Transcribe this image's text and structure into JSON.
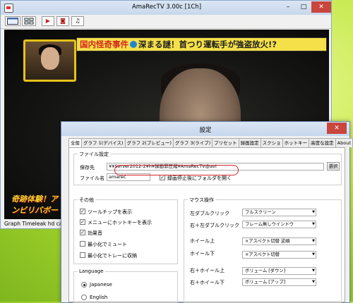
{
  "main_window": {
    "title": "AmaRecTV 3.00c  [1Ch]",
    "controls": {
      "minimize": "–",
      "maximize": "□",
      "close": "✕"
    },
    "toolbar": [
      {
        "name": "preview-window-button",
        "icon": "window-icon"
      },
      {
        "name": "device-select-button",
        "icon": "device-icon"
      },
      {
        "name": "record-button",
        "icon": "play-icon",
        "glyph": "▶"
      },
      {
        "name": "screenshot-button",
        "icon": "camera-icon",
        "glyph": "◙"
      },
      {
        "name": "audio-button",
        "icon": "music-note-icon",
        "glyph": "♫"
      }
    ],
    "video": {
      "headline_part1": "国内怪奇事件",
      "headline_part2": "深まる謎！首つり運転手が強盗放火!?",
      "logo_text": "奇跡体験！アンビリバボー"
    },
    "status": "Graph Timeleak hd captu"
  },
  "settings_dialog": {
    "title": "設定",
    "close": "✕",
    "tabs": [
      "全般",
      "グラフ 1(デバイス)",
      "グラフ 2(プレビュー)",
      "グラフ 3(ライブ)",
      "プリセット",
      "録画設定",
      "スクショ",
      "ホットキー",
      "高度な設定",
      "About"
    ],
    "file_settings": {
      "group_label": "ファイル設定",
      "save_to_label": "保存先",
      "save_to_value": "¥¥Server2012-2¥h¥録画非圧縮¥AmaRecTV@avi",
      "browse_button": "選択",
      "filename_label": "ファイル名",
      "filename_value": "amarec",
      "open_folder_label": "録画停止後にフォルダを開く",
      "open_folder_checked": true
    },
    "other": {
      "group_label": "その他",
      "options": [
        {
          "label": "ツールチップを表示",
          "checked": true
        },
        {
          "label": "メニューにホットキーを表示",
          "checked": true
        },
        {
          "label": "効果音",
          "checked": true
        },
        {
          "label": "最小化でミュート",
          "checked": false
        },
        {
          "label": "最小化でトレーに収納",
          "checked": false
        }
      ]
    },
    "language": {
      "group_label": "Language",
      "options": [
        {
          "label": "Japanese",
          "selected": true
        },
        {
          "label": "English",
          "selected": false
        }
      ]
    },
    "mouse": {
      "group_label": "マウス操作",
      "rows": [
        {
          "label": "左ダブルクリック",
          "value": "フルスクリーン"
        },
        {
          "label": "右＋左ダブルクリック",
          "value": "フレーム無しウインドウ"
        },
        {
          "label": "ホイール上",
          "value": "×アスペクト切替 逆順"
        },
        {
          "label": "ホイール下",
          "value": "×アスペクト切替"
        },
        {
          "label": "右＋ホイール上",
          "value": "ボリューム [ダウン]"
        },
        {
          "label": "右＋ホイール下",
          "value": "ボリューム [アップ]"
        }
      ]
    },
    "colors": {
      "annotation": "#d8232a",
      "titlebar": "#c7d7ec",
      "close": "#c9463d"
    }
  }
}
